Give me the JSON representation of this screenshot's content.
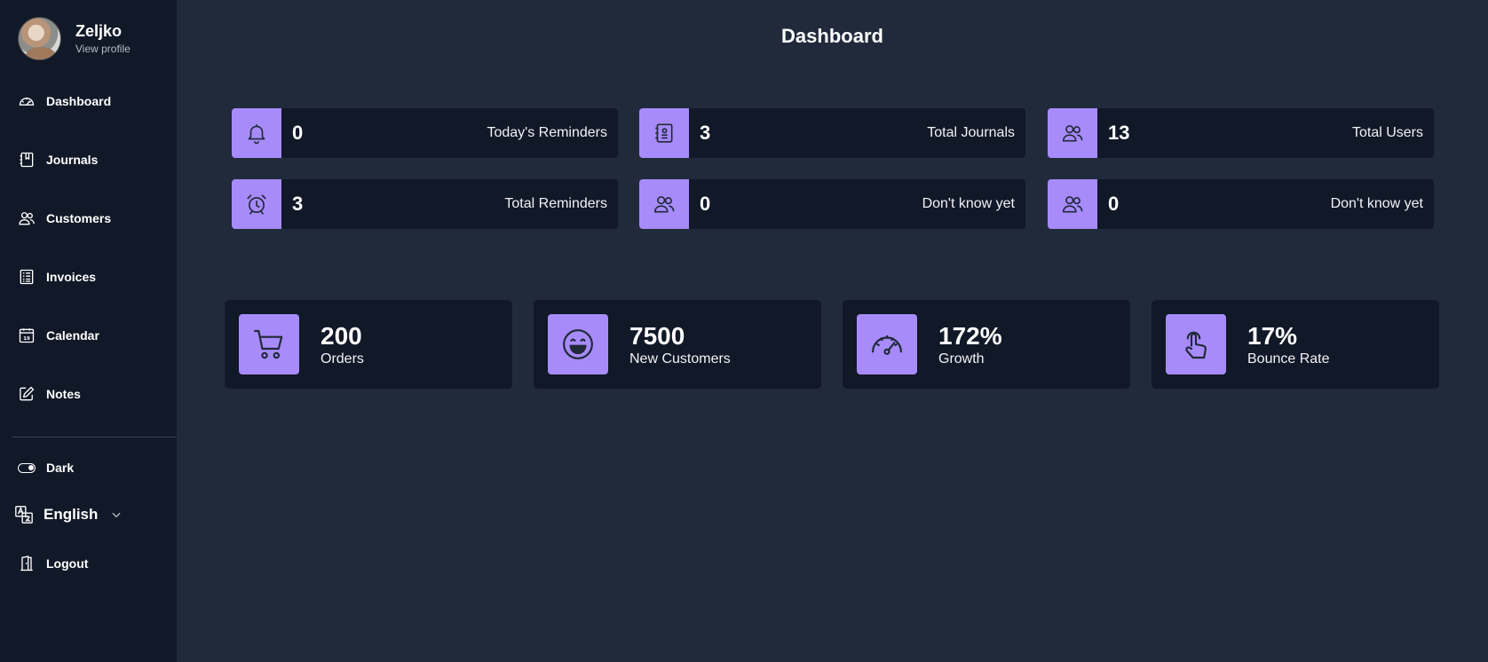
{
  "user": {
    "name": "Zeljko",
    "profile_link": "View profile"
  },
  "nav": {
    "dashboard": "Dashboard",
    "journals": "Journals",
    "customers": "Customers",
    "invoices": "Invoices",
    "calendar": "Calendar",
    "calendar_day": "19",
    "notes": "Notes",
    "theme": "Dark",
    "language": "English",
    "logout": "Logout"
  },
  "page": {
    "title": "Dashboard"
  },
  "stats": [
    {
      "value": "0",
      "label": "Today's Reminders",
      "icon": "bell-icon"
    },
    {
      "value": "3",
      "label": "Total Journals",
      "icon": "journal-icon"
    },
    {
      "value": "13",
      "label": "Total Users",
      "icon": "users-icon"
    },
    {
      "value": "3",
      "label": "Total Reminders",
      "icon": "alarm-clock-icon"
    },
    {
      "value": "0",
      "label": "Don't know yet",
      "icon": "users-icon"
    },
    {
      "value": "0",
      "label": "Don't know yet",
      "icon": "users-icon"
    }
  ],
  "cards": [
    {
      "value": "200",
      "label": "Orders",
      "icon": "cart-icon"
    },
    {
      "value": "7500",
      "label": "New Customers",
      "icon": "smiley-icon"
    },
    {
      "value": "172%",
      "label": "Growth",
      "icon": "speedometer-icon"
    },
    {
      "value": "17%",
      "label": "Bounce Rate",
      "icon": "tap-hand-icon"
    }
  ],
  "colors": {
    "accent": "#a78bfa",
    "sidebar": "#111827",
    "background": "#212a3b",
    "panel": "#111827"
  }
}
